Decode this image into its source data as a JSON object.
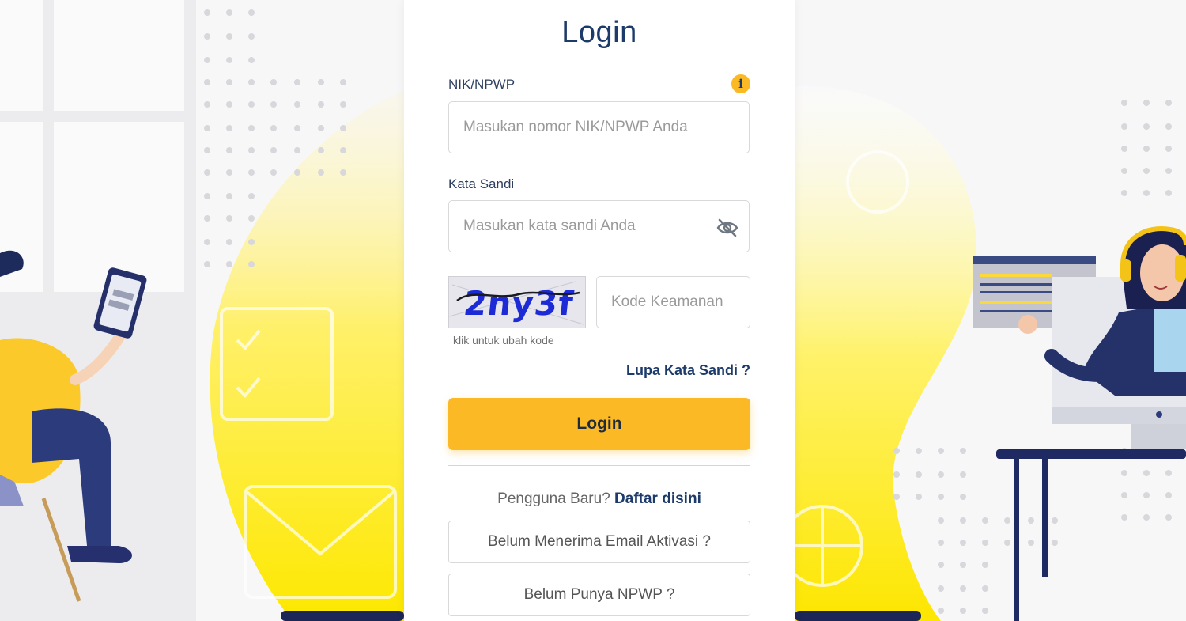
{
  "login": {
    "title": "Login",
    "nik_label": "NIK/NPWP",
    "nik_placeholder": "Masukan nomor NIK/NPWP Anda",
    "password_label": "Kata Sandi",
    "password_placeholder": "Masukan kata sandi Anda",
    "captcha_text": "2ny3f",
    "captcha_hint": "klik untuk ubah kode",
    "security_code_placeholder": "Kode Keamanan",
    "forgot_password": "Lupa Kata Sandi ?",
    "login_button": "Login",
    "new_user_text": "Pengguna Baru?",
    "register_link": "Daftar disini",
    "no_activation_email_button": "Belum Menerima Email Aktivasi ?",
    "no_npwp_button": "Belum Punya NPWP ?"
  },
  "icons": {
    "info": "info-icon",
    "password_visibility": "eye-slash-icon"
  },
  "colors": {
    "primary_navy": "#1d3b6a",
    "accent_yellow": "#fbb926",
    "border": "#d9d9d9"
  }
}
